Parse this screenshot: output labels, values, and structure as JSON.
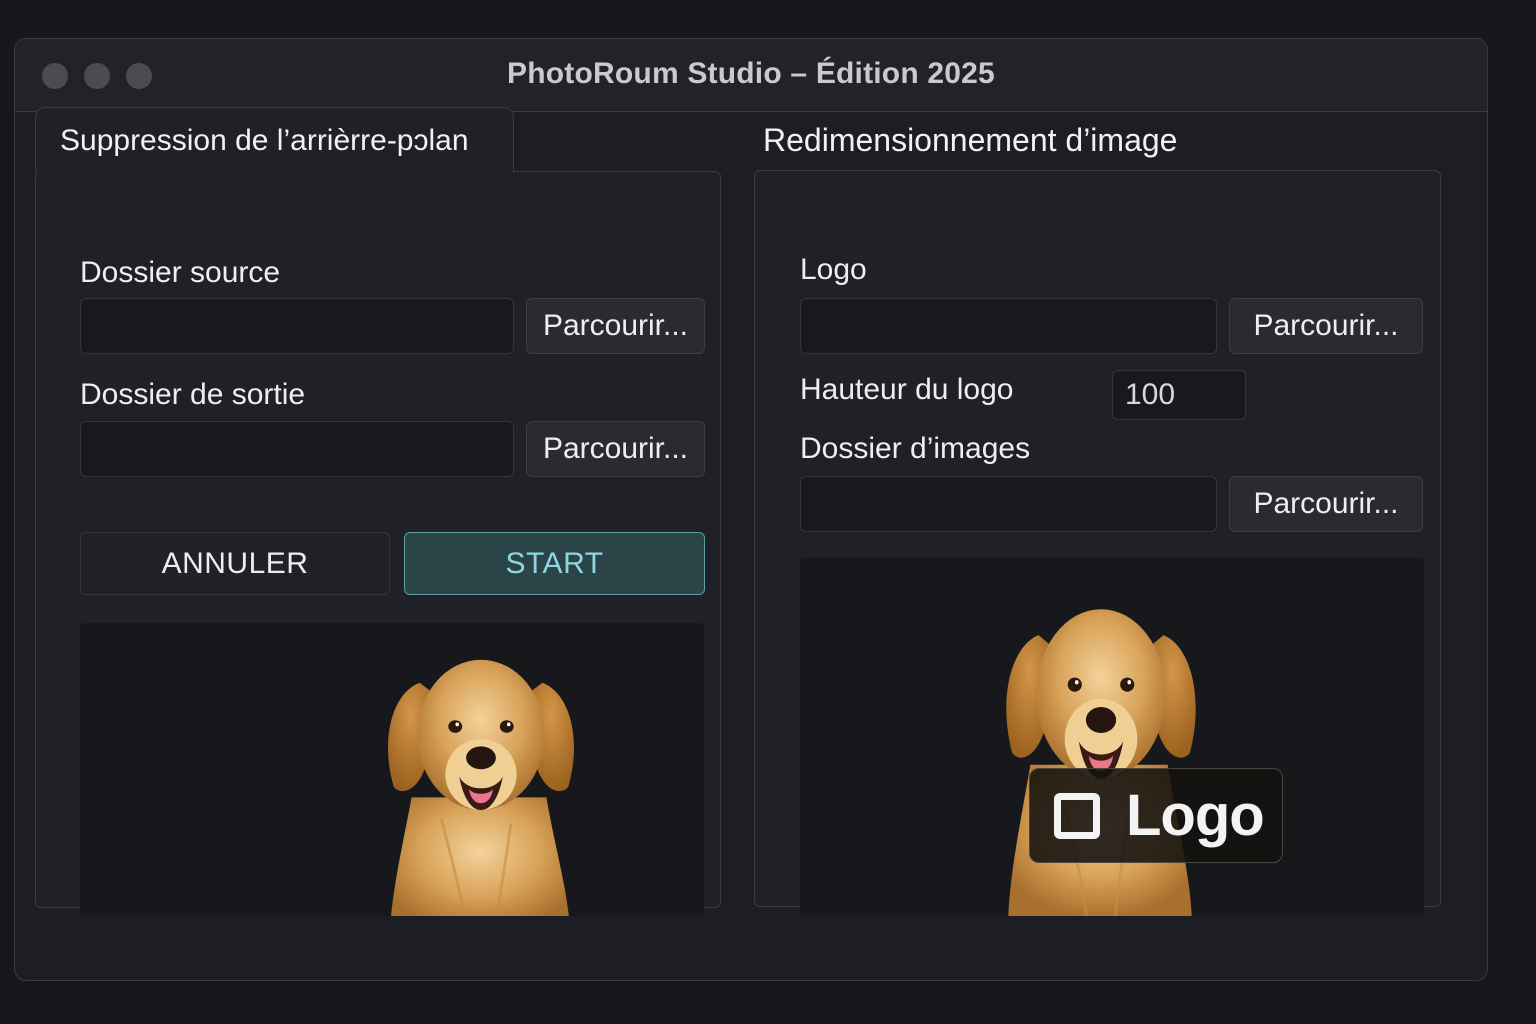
{
  "window": {
    "title": "PhotoRoum Studio – Édition 2025"
  },
  "left_panel": {
    "tab_label": "Suppression de l’arrièrre-pɔlan",
    "source_label": "Dossier source",
    "source_value": "",
    "source_browse": "Parcourir...",
    "output_label": "Dossier de sortie",
    "output_value": "",
    "output_browse": "Parcourir...",
    "cancel_label": "ANNULER",
    "start_label": "START",
    "preview_icon": "golden-retriever-cutout"
  },
  "right_panel": {
    "heading": "Redimensionnement d’image",
    "logo_label": "Logo",
    "logo_value": "",
    "logo_browse": "Parcourir...",
    "height_label": "Hauteur du logo",
    "height_value": "100",
    "images_label": "Dossier d’images",
    "images_value": "",
    "images_browse": "Parcourir...",
    "preview_icon": "golden-retriever-with-logo",
    "logo_badge_text": "Logo"
  },
  "colors": {
    "background": "#17181c",
    "panel": "#202126",
    "accent": "#8fd6e0",
    "start_button_bg": "#2a4448"
  }
}
